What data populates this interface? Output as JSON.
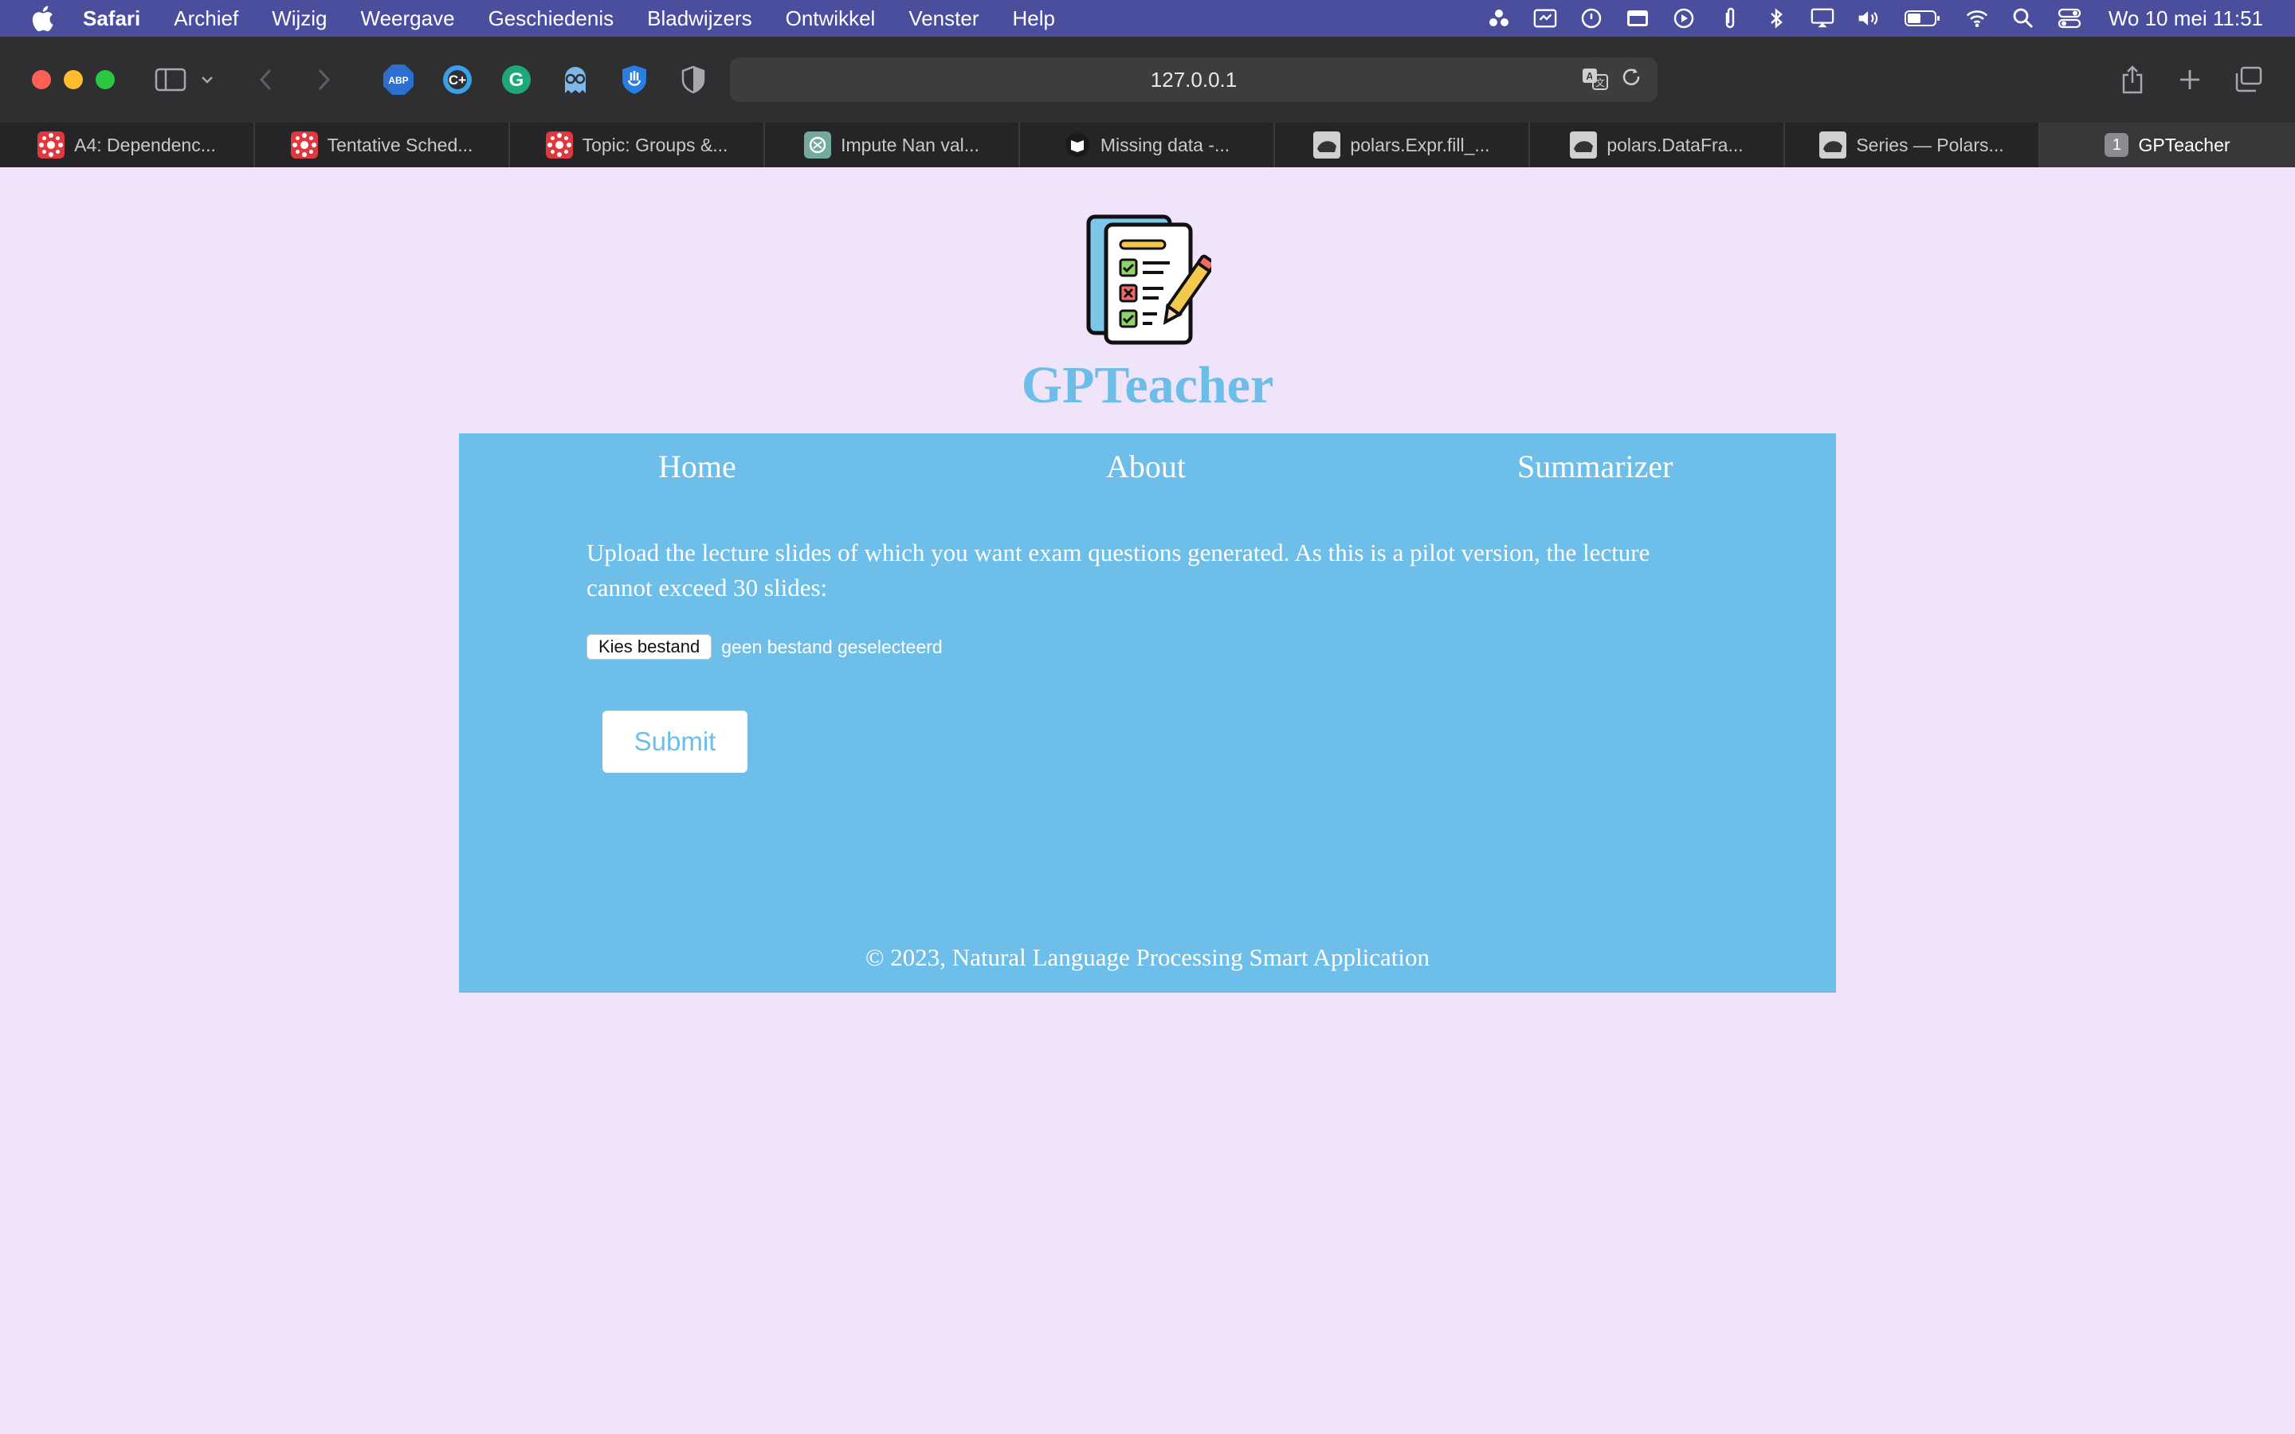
{
  "menubar": {
    "app_name": "Safari",
    "items": [
      "Archief",
      "Wijzig",
      "Weergave",
      "Geschiedenis",
      "Bladwijzers",
      "Ontwikkel",
      "Venster",
      "Help"
    ],
    "clock": "Wo 10 mei  11:51"
  },
  "browser": {
    "url": "127.0.0.1",
    "tabs": [
      {
        "title": "A4: Dependenc...",
        "favicon": "canvas-icon"
      },
      {
        "title": "Tentative Sched...",
        "favicon": "canvas-icon"
      },
      {
        "title": "Topic: Groups &...",
        "favicon": "canvas-icon"
      },
      {
        "title": "Impute Nan val...",
        "favicon": "chatgpt-icon"
      },
      {
        "title": "Missing data -...",
        "favicon": "book-icon"
      },
      {
        "title": "polars.Expr.fill_...",
        "favicon": "polars-icon"
      },
      {
        "title": "polars.DataFra...",
        "favicon": "polars-icon"
      },
      {
        "title": "Series — Polars...",
        "favicon": "polars-icon"
      }
    ],
    "active_tab": {
      "number": "1",
      "title": "GPTeacher"
    }
  },
  "site": {
    "title": "GPTeacher",
    "nav": {
      "home": "Home",
      "about": "About",
      "summarizer": "Summarizer"
    },
    "intro": "Upload the lecture slides of which you want exam questions generated. As this is a pilot version, the lecture cannot exceed 30 slides:",
    "file_button": "Kies bestand",
    "file_status": "geen bestand geselecteerd",
    "submit": "Submit",
    "footer": "© 2023, Natural Language Processing Smart Application"
  },
  "colors": {
    "accent": "#6dbee9",
    "page_background": "#f0e4fa",
    "menubar": "#4b4e9c"
  }
}
